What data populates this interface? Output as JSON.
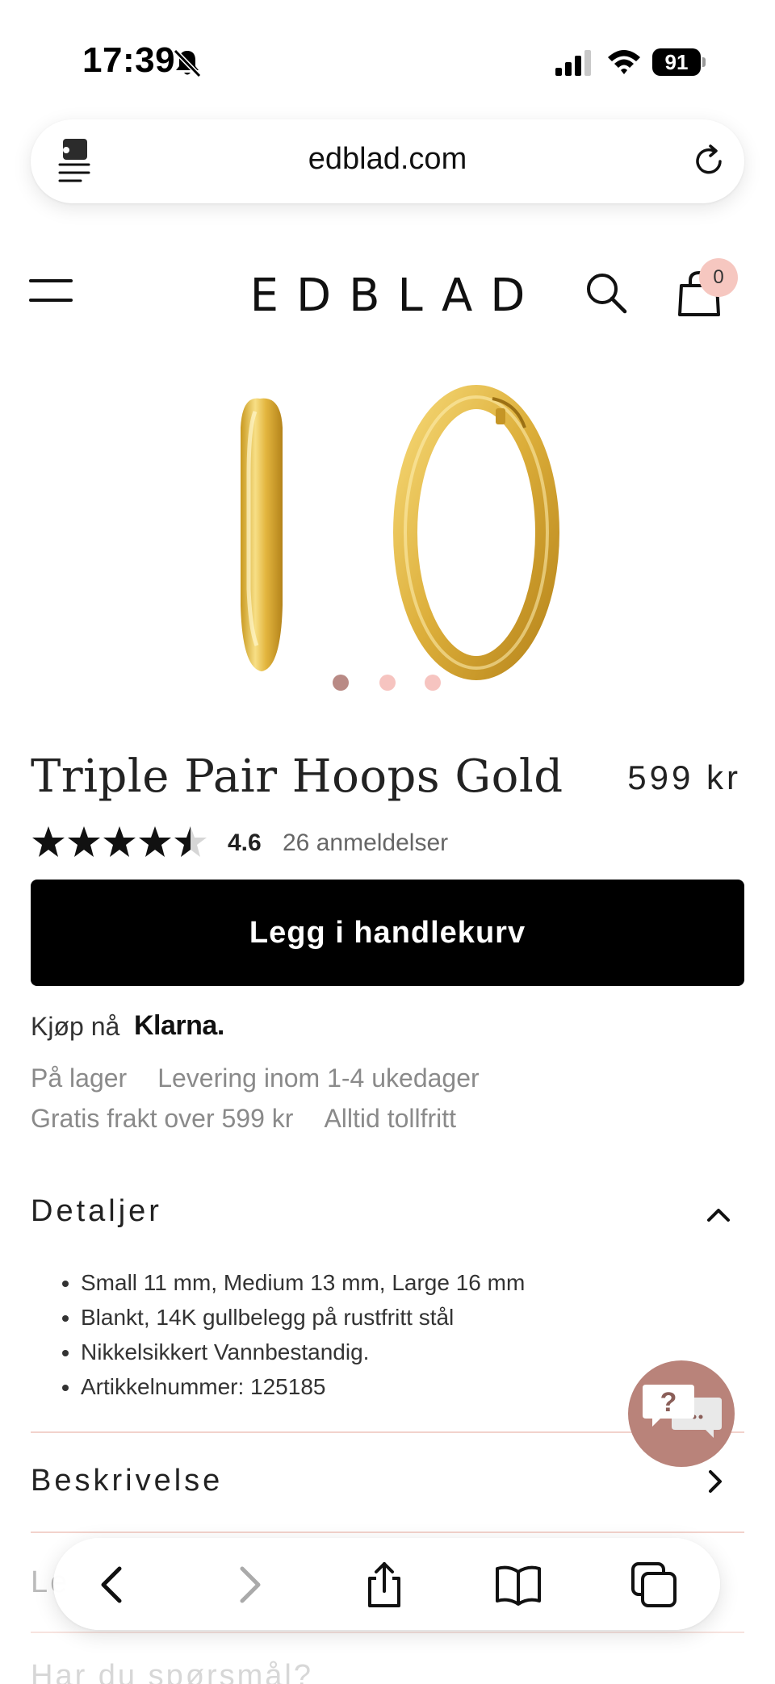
{
  "status_bar": {
    "time": "17:39",
    "battery": "91"
  },
  "browser": {
    "url": "edblad.com"
  },
  "site": {
    "logo": "EDBLAD",
    "cart_count": "0"
  },
  "product": {
    "title": "Triple Pair Hoops Gold",
    "price": "599 kr",
    "rating_value": "4.6",
    "rating_stars": 4.6,
    "review_count": "26 anmeldelser",
    "image_count": 3,
    "active_image": 1,
    "add_to_cart_label": "Legg i handlekurv"
  },
  "klarna": {
    "label": "Kjøp nå",
    "brand": "Klarna."
  },
  "info": {
    "row1": [
      "På lager",
      "Levering inom 1-4 ukedager"
    ],
    "row2": [
      "Gratis frakt over 599 kr",
      "Alltid tollfritt"
    ]
  },
  "details": {
    "title": "Detaljer",
    "items": [
      "Small 11 mm, Medium 13 mm, Large 16 mm",
      "Blankt, 14K gullbelegg på rustfritt stål",
      "Nikkelsikkert Vannbestandig.",
      "Artikkelnummer: 125185"
    ]
  },
  "description": {
    "title": "Beskrivelse"
  },
  "partially_hidden": {
    "section_letters": "Le",
    "question": "Har du spørsmål?"
  },
  "colors": {
    "accent_pink": "#f6c7c0",
    "chat_bubble": "#b9837a",
    "dot_active": "#b98a85",
    "dot_inactive": "#f6c4c0"
  }
}
